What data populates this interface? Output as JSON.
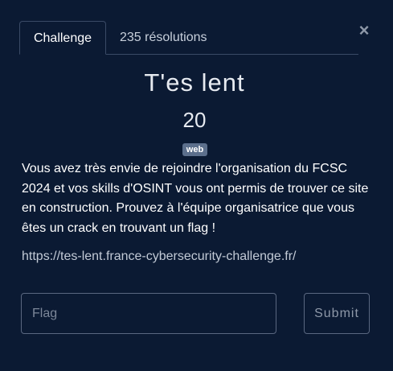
{
  "tabs": [
    {
      "label": "Challenge",
      "active": true
    },
    {
      "label": "235 résolutions",
      "active": false
    }
  ],
  "close_icon": "×",
  "challenge": {
    "title": "T'es lent",
    "points": "20",
    "category": "web",
    "description": "Vous avez très envie de rejoindre l'organisation du FCSC 2024 et vos skills d'OSINT vous ont permis de trouver ce site en construction. Prouvez à l'équipe organisatrice que vous êtes un crack en trouvant un flag !",
    "link": "https://tes-lent.france-cybersecurity-challenge.fr/"
  },
  "form": {
    "flag_placeholder": "Flag",
    "flag_value": "",
    "submit_label": "Submit"
  },
  "colors": {
    "background": "#0b1a33",
    "border": "#3a4a66",
    "badge": "#5c6f8c"
  }
}
